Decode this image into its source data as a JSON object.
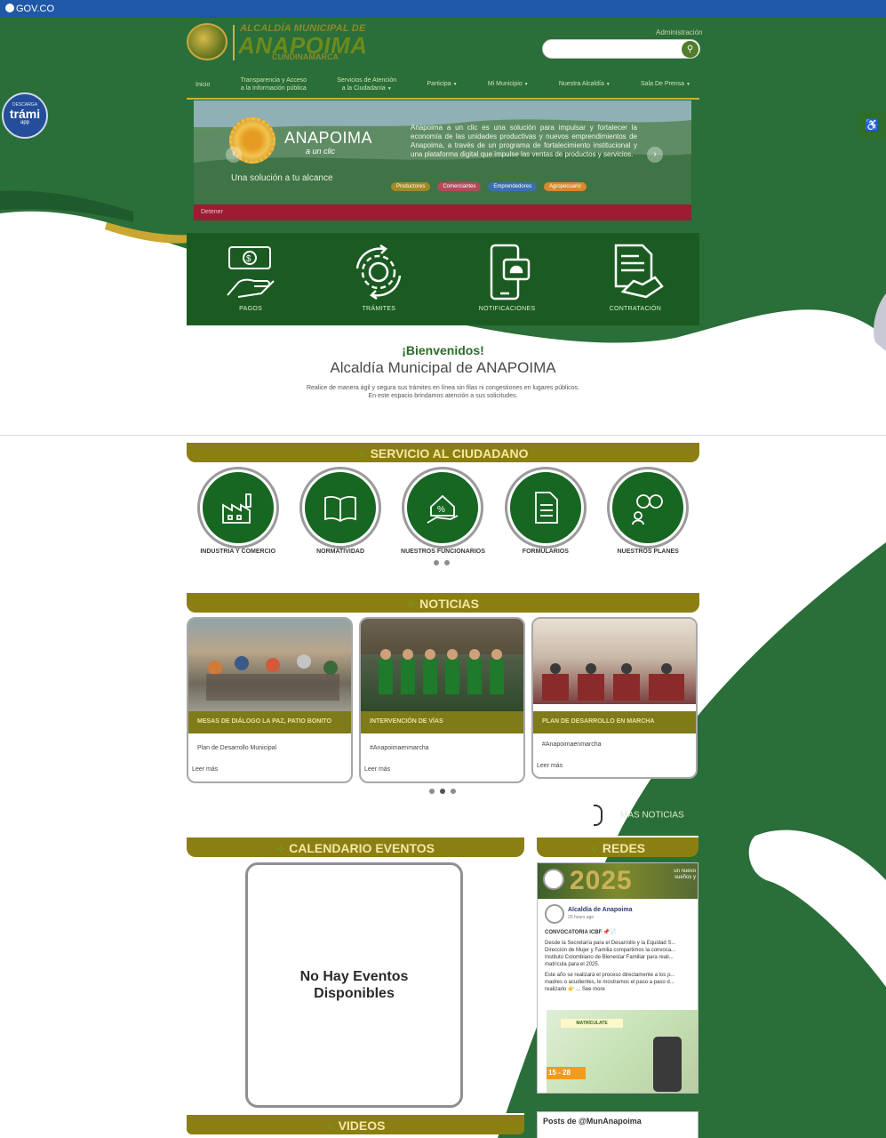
{
  "govbar": {
    "label": "GOV.CO"
  },
  "header": {
    "logo_line1": "ALCALDÍA MUNICIPAL DE",
    "logo_line2": "ANAPOIMA",
    "logo_line3": "CUNDINAMARCA",
    "admin_link": "Administración",
    "search_placeholder": ""
  },
  "nav": {
    "items": [
      {
        "label": "Inicio"
      },
      {
        "label": "Transparencia y Acceso",
        "label2": "a la Información pública"
      },
      {
        "label": "Servicios de Atención",
        "label2": "a la Ciudadanía"
      },
      {
        "label": "Participa"
      },
      {
        "label": "Mi Municipio"
      },
      {
        "label": "Nuestra Alcaldía"
      },
      {
        "label": "Sala De Prensa"
      }
    ]
  },
  "tramiapp": {
    "small": "DESCARGA",
    "big": "trámi",
    "app": "app"
  },
  "banner": {
    "brand": "ANAPOIMA",
    "brand_sub": "a un clic",
    "tagline": "Una solución a tu alcance",
    "description": "Anapoima a un clic es una solución para impulsar y fortalecer la economía de las unidades productivas y nuevos emprendimientos de Anapoima, a través de un programa de fortalecimiento institucional y una plataforma digital que impulse las ventas de productos y servicios.",
    "pills": [
      "Productores",
      "Comerciantes",
      "Emprendedores",
      "Agropecuario"
    ],
    "pause_label": "Detener"
  },
  "quick": {
    "items": [
      "PAGOS",
      "TRÁMITES",
      "NOTIFICACIONES",
      "CONTRATACIÓN"
    ]
  },
  "welcome": {
    "title": "¡Bienvenidos!",
    "subtitle": "Alcaldía Municipal de ANAPOIMA",
    "line1": "Realice de manera ágil y segura sus trámites en línea sin filas ni congestiones en lugares públicos.",
    "line2": "En este espacio brindamos atención a sus solicitudes."
  },
  "servicio": {
    "heading": "SERVICIO AL CIUDADANO",
    "items": [
      "INDUSTRIA Y COMERCIO",
      "NORMATIVIDAD",
      "NUESTROS FUNCIONARIOS",
      "FORMULARIOS",
      "NUESTROS PLANES"
    ]
  },
  "noticias": {
    "heading": "NOTICIAS",
    "cards": [
      {
        "title": "MESAS DE DIÁLOGO LA PAZ, PATIO BONITO",
        "body": "Plan de Desarrollo Municipal",
        "more": "Leer más"
      },
      {
        "title": "INTERVENCIÓN DE VÍAS",
        "body": "#Anapoimaenmarcha",
        "more": "Leer más"
      },
      {
        "title": "PLAN DE DESARROLLO EN MARCHA",
        "body": "#Anapoimaenmarcha",
        "more": "Leer más"
      }
    ],
    "more_news": "MÁS NOTICIAS"
  },
  "calendario": {
    "heading": "CALENDARIO EVENTOS",
    "empty_line1": "No Hay Eventos",
    "empty_line2": "Disponibles"
  },
  "redes": {
    "heading": "REDES",
    "cover_year": "2025",
    "cover_small1": "un nuevo",
    "cover_small2": "sueños y",
    "page_name": "Alcaldía de Anapoima",
    "post_time": "20 hours ago",
    "post_heading": "CONVOCATORIA ICBF 📌📄",
    "post_p1": "Desde la Secretaría para el Desarrollo y la Equidad S... Dirección de Mujer y Familia compartimos la convoca... Instituto Colombiano de Bienestar Familiar para reali... matrícula para el 2025.",
    "post_p2": "Este año se realizará el proceso directamente a los p... madres o acudientes, le mostramos el paso a paso d... realizarlo 👉 ... See more",
    "image_banner": "MATRÍCULATE",
    "image_dates": "15 - 28"
  },
  "twitter": {
    "label": "Posts de @MunAnapoima"
  },
  "videos": {
    "heading": "VIDEOS"
  },
  "colors": {
    "primary_green": "#1b5b22",
    "gold": "#8b7f14",
    "gov_blue": "#1f58a8",
    "banner_red": "#9b1c33"
  }
}
